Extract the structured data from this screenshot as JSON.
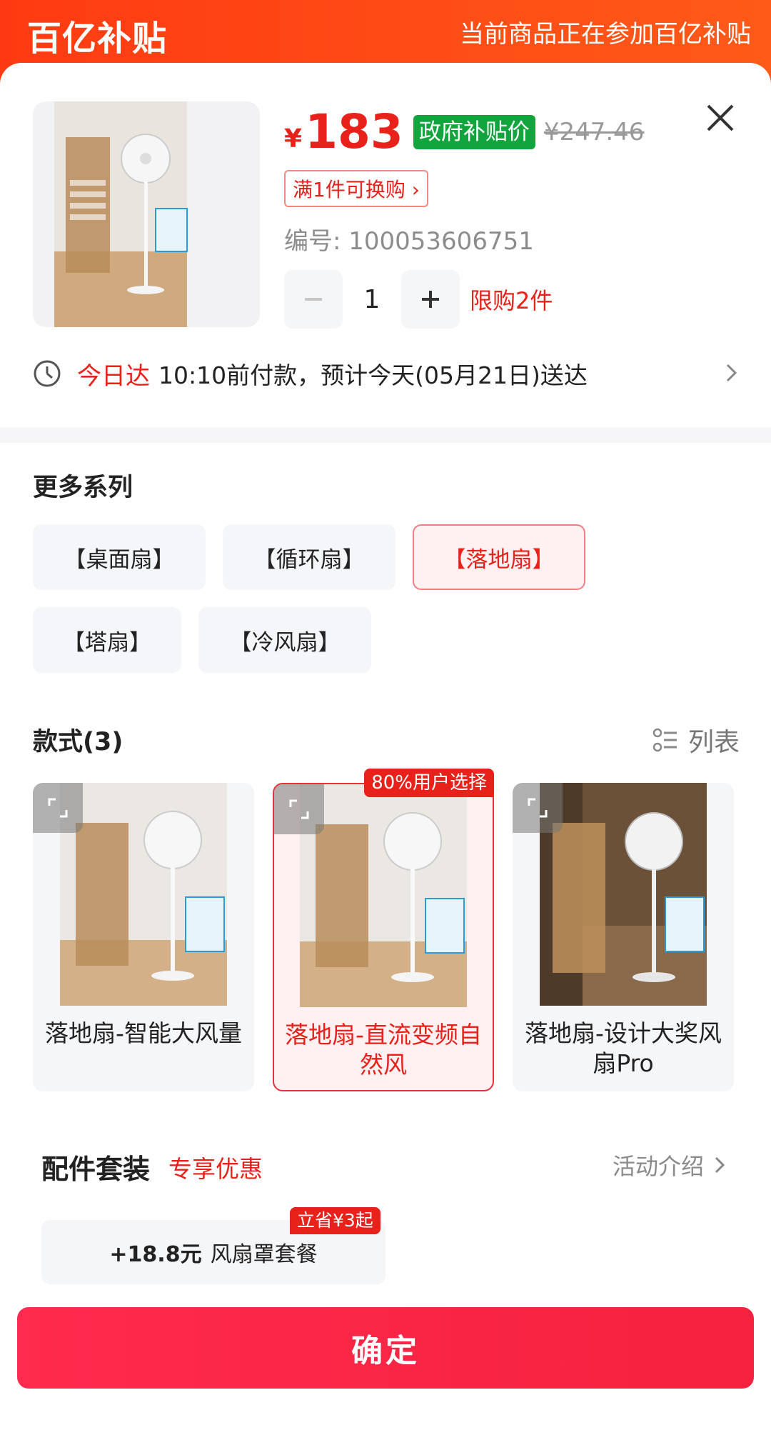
{
  "banner": {
    "brand": "百亿补贴",
    "note": "当前商品正在参加百亿补贴"
  },
  "product": {
    "currency": "¥",
    "price": "183",
    "gov_tag": "政府补贴价",
    "original_price": "¥247.46",
    "exchange": "满1件可换购 ›",
    "sku": "编号: 100053606751",
    "quantity": "1",
    "limit": "限购2件"
  },
  "delivery": {
    "badge": "今日达",
    "text": "10:10前付款，预计今天(05月21日)送达"
  },
  "series": {
    "title": "更多系列",
    "items": [
      "【桌面扇】",
      "【循环扇】",
      "【落地扇】",
      "【塔扇】",
      "【冷风扇】"
    ],
    "selected": "【落地扇】"
  },
  "styles": {
    "title": "款式(3)",
    "list_toggle": "列表",
    "badge": "80%用户选择",
    "items": [
      {
        "label": "落地扇-智能大风量"
      },
      {
        "label": "落地扇-直流变频自然风"
      },
      {
        "label": "落地扇-设计大奖风扇Pro"
      }
    ]
  },
  "accessories": {
    "title": "配件套装",
    "subtitle": "专享优惠",
    "link": "活动介绍",
    "package_price": "+18.8元",
    "package_name": "风扇罩套餐",
    "save_badge": "立省¥3起"
  },
  "confirm": "确定",
  "colors": {
    "accent_red": "#e8211b",
    "banner_orange": "#ff4a12",
    "gov_green": "#13a53d",
    "button_red": "#f5213e"
  }
}
